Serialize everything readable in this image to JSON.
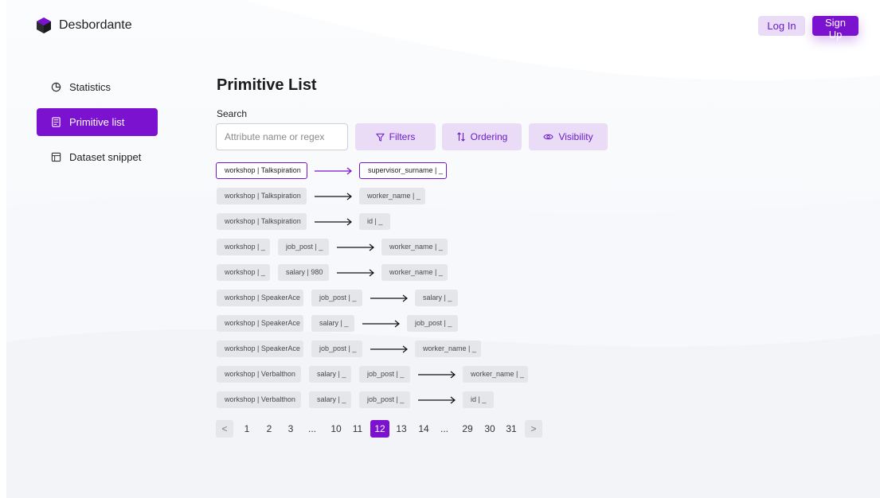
{
  "app": {
    "name": "Desbordante"
  },
  "header": {
    "login_label": "Log In",
    "signup_label": "Sign Up"
  },
  "sidebar": {
    "items": [
      {
        "label": "Statistics",
        "icon": "pie-chart-icon",
        "active": false
      },
      {
        "label": "Primitive list",
        "icon": "list-icon",
        "active": true
      },
      {
        "label": "Dataset snippet",
        "icon": "table-icon",
        "active": false
      }
    ]
  },
  "main": {
    "title": "Primitive List",
    "search": {
      "label": "Search",
      "placeholder": "Attribute name or regex",
      "value": ""
    },
    "buttons": {
      "filters": "Filters",
      "ordering": "Ordering",
      "visibility": "Visibility"
    },
    "rows": [
      {
        "lhs": [
          "workshop | Talkspiration"
        ],
        "rhs": "supervisor_surname | _",
        "selected": true
      },
      {
        "lhs": [
          "workshop | Talkspiration"
        ],
        "rhs": "worker_name | _"
      },
      {
        "lhs": [
          "workshop | Talkspiration"
        ],
        "rhs": "id | _"
      },
      {
        "lhs": [
          "workshop | _",
          "job_post | _"
        ],
        "rhs": "worker_name | _"
      },
      {
        "lhs": [
          "workshop | _",
          "salary | 980"
        ],
        "rhs": "worker_name | _"
      },
      {
        "lhs": [
          "workshop | SpeakerAce",
          "job_post | _"
        ],
        "rhs": "salary | _"
      },
      {
        "lhs": [
          "workshop | SpeakerAce",
          "salary | _"
        ],
        "rhs": "job_post | _"
      },
      {
        "lhs": [
          "workshop | SpeakerAce",
          "job_post | _"
        ],
        "rhs": "worker_name | _"
      },
      {
        "lhs": [
          "workshop | Verbalthon",
          "salary | _",
          "job_post | _"
        ],
        "rhs": "worker_name | _"
      },
      {
        "lhs": [
          "workshop | Verbalthon",
          "salary | _",
          "job_post | _"
        ],
        "rhs": "id | _"
      }
    ],
    "pagination": {
      "prev": "<",
      "next": ">",
      "current": "12",
      "pages": [
        "1",
        "2",
        "3",
        "...",
        "10",
        "11",
        "12",
        "13",
        "14",
        "...",
        "29",
        "30",
        "31"
      ]
    }
  },
  "colors": {
    "accent": "#7a12cf",
    "accent_light": "#eadcf7",
    "chip": "#e5e6e9"
  }
}
